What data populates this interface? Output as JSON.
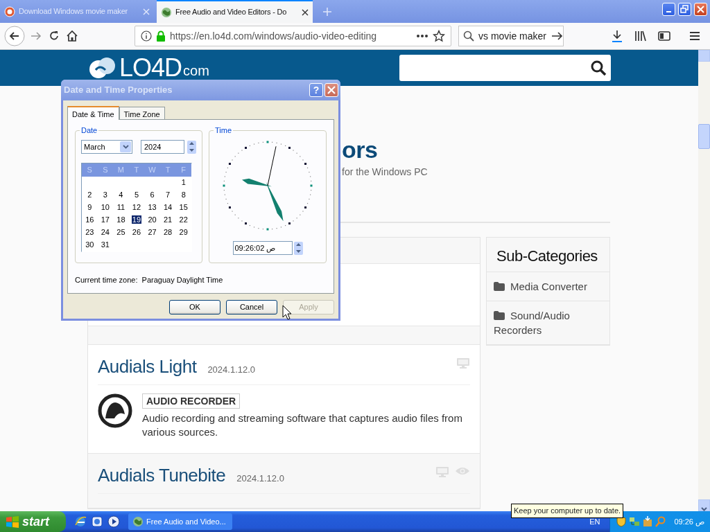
{
  "browser": {
    "tabs": [
      {
        "label": "Download Windows movie maker",
        "selected": false
      },
      {
        "label": "Free Audio and Video Editors - Do",
        "selected": true
      }
    ],
    "url": "https://en.lo4d.com/windows/audio-video-editing",
    "search_value": "vs movie maker"
  },
  "site": {
    "logo": "LO4D",
    "logo_suffix": "com",
    "heading": "ors",
    "subtitle": "for the Windows PC"
  },
  "listings": [
    {
      "name": "Audials Light",
      "version": "2024.1.12.0",
      "category": "AUDIO RECORDER",
      "description": "Audio recording and streaming software that captures audio files from various sources."
    },
    {
      "name": "Audials Tunebite",
      "version": "2024.1.12.0"
    }
  ],
  "sidebar": {
    "title": "Sub-Categories",
    "items": [
      "Media Converter",
      "Sound/Audio Recorders"
    ]
  },
  "dialog": {
    "title": "Date and Time Properties",
    "help": "?",
    "tabs": [
      {
        "label": "Date & Time",
        "selected": true
      },
      {
        "label": "Time Zone",
        "selected": false
      }
    ],
    "date_group": "Date",
    "month": "March",
    "year": "2024",
    "weekdays": [
      "S",
      "S",
      "M",
      "T",
      "W",
      "T",
      "F"
    ],
    "weeks": [
      [
        {
          "day": "1",
          "selected": false
        }
      ],
      [
        {
          "day": "2",
          "selected": false
        },
        {
          "day": "3",
          "selected": false
        },
        {
          "day": "4",
          "selected": false
        },
        {
          "day": "5",
          "selected": false
        },
        {
          "day": "6",
          "selected": false
        },
        {
          "day": "7",
          "selected": false
        },
        {
          "day": "8",
          "selected": false
        }
      ],
      [
        {
          "day": "9",
          "selected": false
        },
        {
          "day": "10",
          "selected": false
        },
        {
          "day": "11",
          "selected": false
        },
        {
          "day": "12",
          "selected": false
        },
        {
          "day": "13",
          "selected": false
        },
        {
          "day": "14",
          "selected": false
        },
        {
          "day": "15",
          "selected": false
        }
      ],
      [
        {
          "day": "16",
          "selected": false
        },
        {
          "day": "17",
          "selected": false
        },
        {
          "day": "18",
          "selected": false
        },
        {
          "day": "19",
          "selected": true
        },
        {
          "day": "20",
          "selected": false
        },
        {
          "day": "21",
          "selected": false
        },
        {
          "day": "22",
          "selected": false
        }
      ],
      [
        {
          "day": "23",
          "selected": false
        },
        {
          "day": "24",
          "selected": false
        },
        {
          "day": "25",
          "selected": false
        },
        {
          "day": "26",
          "selected": false
        },
        {
          "day": "27",
          "selected": false
        },
        {
          "day": "28",
          "selected": false
        },
        {
          "day": "29",
          "selected": false
        }
      ],
      [
        {
          "day": "30",
          "selected": false
        },
        {
          "day": "31",
          "selected": false
        }
      ]
    ],
    "time_group": "Time",
    "time": "09:26:02 ص",
    "timezone": "Current time zone:  Paraguay Daylight Time",
    "buttons": [
      {
        "label": "OK",
        "disabled": false
      },
      {
        "label": "Cancel",
        "disabled": false
      },
      {
        "label": "Apply",
        "disabled": true
      }
    ]
  },
  "taskbar": {
    "start": "start",
    "task": "Free Audio and Video...",
    "language": "EN",
    "clock": "09:26 ص",
    "tooltip": "Keep your computer up to date."
  }
}
